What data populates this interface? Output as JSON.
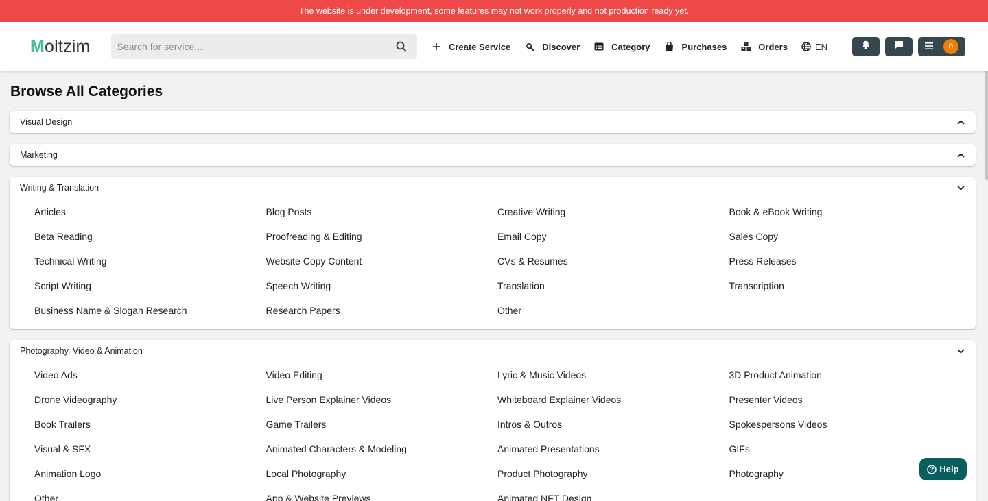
{
  "banner": {
    "text": "The website is under development, some features may not work properly and not production ready yet."
  },
  "header": {
    "logo_first": "M",
    "logo_rest": "oltzim",
    "search_placeholder": "Search for service...",
    "nav": [
      {
        "label": "Create Service",
        "icon": "plus-icon"
      },
      {
        "label": "Discover",
        "icon": "discover-icon"
      },
      {
        "label": "Category",
        "icon": "list-icon"
      },
      {
        "label": "Purchases",
        "icon": "bag-icon"
      },
      {
        "label": "Orders",
        "icon": "orders-icon"
      }
    ],
    "language": "EN",
    "cart_count": "0"
  },
  "page_title": "Browse All Categories",
  "categories": [
    {
      "name": "Visual Design",
      "expanded": false,
      "items": []
    },
    {
      "name": "Marketing",
      "expanded": false,
      "items": []
    },
    {
      "name": "Writing & Translation",
      "expanded": true,
      "items": [
        "Articles",
        "Blog Posts",
        "Creative Writing",
        "Book & eBook Writing",
        "Beta Reading",
        "Proofreading & Editing",
        "Email Copy",
        "Sales Copy",
        "Technical Writing",
        "Website Copy Content",
        "CVs & Resumes",
        "Press Releases",
        "Script Writing",
        "Speech Writing",
        "Translation",
        "Transcription",
        "Business Name & Slogan Research",
        "Research Papers",
        "Other"
      ]
    },
    {
      "name": "Photography, Video & Animation",
      "expanded": true,
      "items": [
        "Video Ads",
        "Video Editing",
        "Lyric & Music Videos",
        "3D Product Animation",
        "Drone Videography",
        "Live Person Explainer Videos",
        "Whiteboard Explainer Videos",
        "Presenter Videos",
        "Book Trailers",
        "Game Trailers",
        "Intros & Outros",
        "Spokespersons Videos",
        "Visual & SFX",
        "Animated Characters & Modeling",
        "Animated Presentations",
        "GIFs",
        "Animation Logo",
        "Local Photography",
        "Product Photography",
        "Photography",
        "Other",
        "App & Website Previews",
        "Animated NFT Design"
      ]
    }
  ],
  "help": {
    "label": "Help",
    "icon": "help-circle-icon"
  },
  "colors": {
    "banner": "#ef4848",
    "logo_accent": "#3fbf93",
    "dark_button": "#36474f",
    "badge": "#f57c00",
    "help": "#0b5e5e"
  }
}
